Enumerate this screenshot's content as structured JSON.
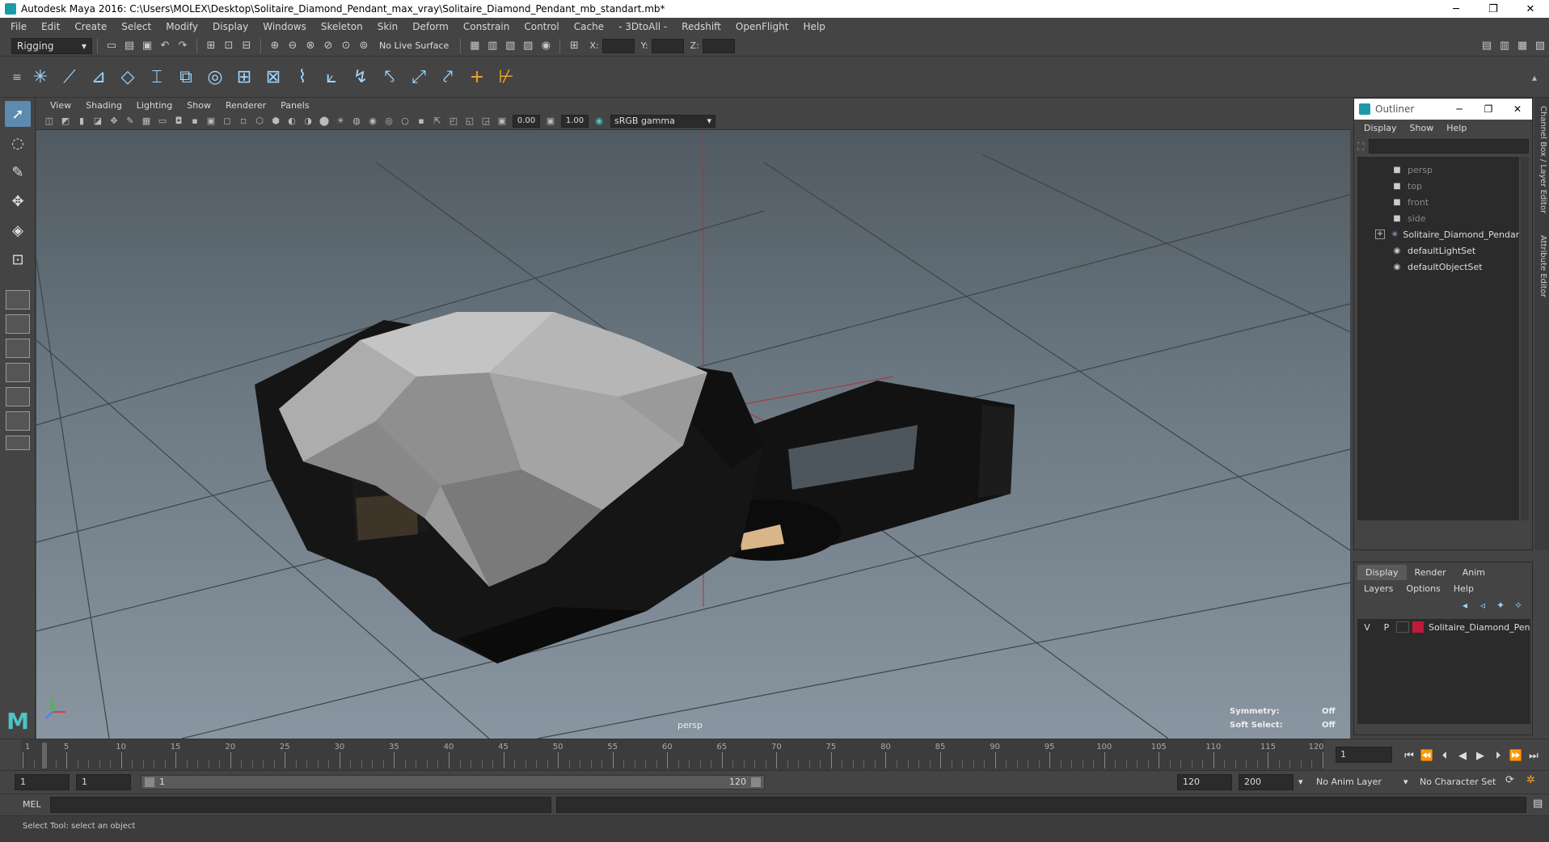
{
  "window": {
    "title": "Autodesk Maya 2016: C:\\Users\\MOLEX\\Desktop\\Solitaire_Diamond_Pendant_max_vray\\Solitaire_Diamond_Pendant_mb_standart.mb*",
    "minimize": "─",
    "restore": "❐",
    "close": "✕"
  },
  "menubar": [
    "File",
    "Edit",
    "Create",
    "Select",
    "Modify",
    "Display",
    "Windows",
    "Skeleton",
    "Skin",
    "Deform",
    "Constrain",
    "Control",
    "Cache",
    "- 3DtoAll -",
    "Redshift",
    "OpenFlight",
    "Help"
  ],
  "statusline": {
    "menu_set": "Rigging",
    "live_surface": "No Live Surface",
    "x_label": "X:",
    "y_label": "Y:",
    "z_label": "Z:"
  },
  "viewport": {
    "menu": [
      "View",
      "Shading",
      "Lighting",
      "Show",
      "Renderer",
      "Panels"
    ],
    "near_value": "0.00",
    "far_value": "1.00",
    "color_space": "sRGB gamma",
    "camera_label": "persp",
    "symmetry_label": "Symmetry:",
    "symmetry_value": "Off",
    "soft_select_label": "Soft Select:",
    "soft_select_value": "Off"
  },
  "outliner": {
    "title": "Outliner",
    "menu": [
      "Display",
      "Show",
      "Help"
    ],
    "items": [
      {
        "label": "persp",
        "dim": true
      },
      {
        "label": "top",
        "dim": true
      },
      {
        "label": "front",
        "dim": true
      },
      {
        "label": "side",
        "dim": true
      },
      {
        "label": "Solitaire_Diamond_Pendar",
        "dim": false
      },
      {
        "label": "defaultLightSet",
        "dim": false
      },
      {
        "label": "defaultObjectSet",
        "dim": false
      }
    ]
  },
  "side_tabs": {
    "channel_box": "Channel Box / Layer Editor",
    "attribute_editor": "Attribute Editor"
  },
  "layer_editor": {
    "tabs": [
      "Display",
      "Render",
      "Anim"
    ],
    "menu": [
      "Layers",
      "Options",
      "Help"
    ],
    "layer": {
      "v": "V",
      "p": "P",
      "name": "Solitaire_Diamond_Pen",
      "color": "#c0193c"
    }
  },
  "timeslider": {
    "ticks": [
      "5",
      "10",
      "15",
      "20",
      "25",
      "30",
      "35",
      "40",
      "45",
      "50",
      "55",
      "60",
      "65",
      "70",
      "75",
      "80",
      "85",
      "90",
      "95",
      "100",
      "105",
      "110",
      "115",
      "120"
    ],
    "start_tick": "1",
    "current_frame": "1"
  },
  "rangeslider": {
    "start": "1",
    "playback_start": "1",
    "range_start_label": "1",
    "range_end_label": "120",
    "playback_end": "120",
    "end": "200",
    "anim_layer": "No Anim Layer",
    "character_set": "No Character Set"
  },
  "cmdline": {
    "label": "MEL"
  },
  "helpline": {
    "text": "Select Tool: select an object"
  }
}
